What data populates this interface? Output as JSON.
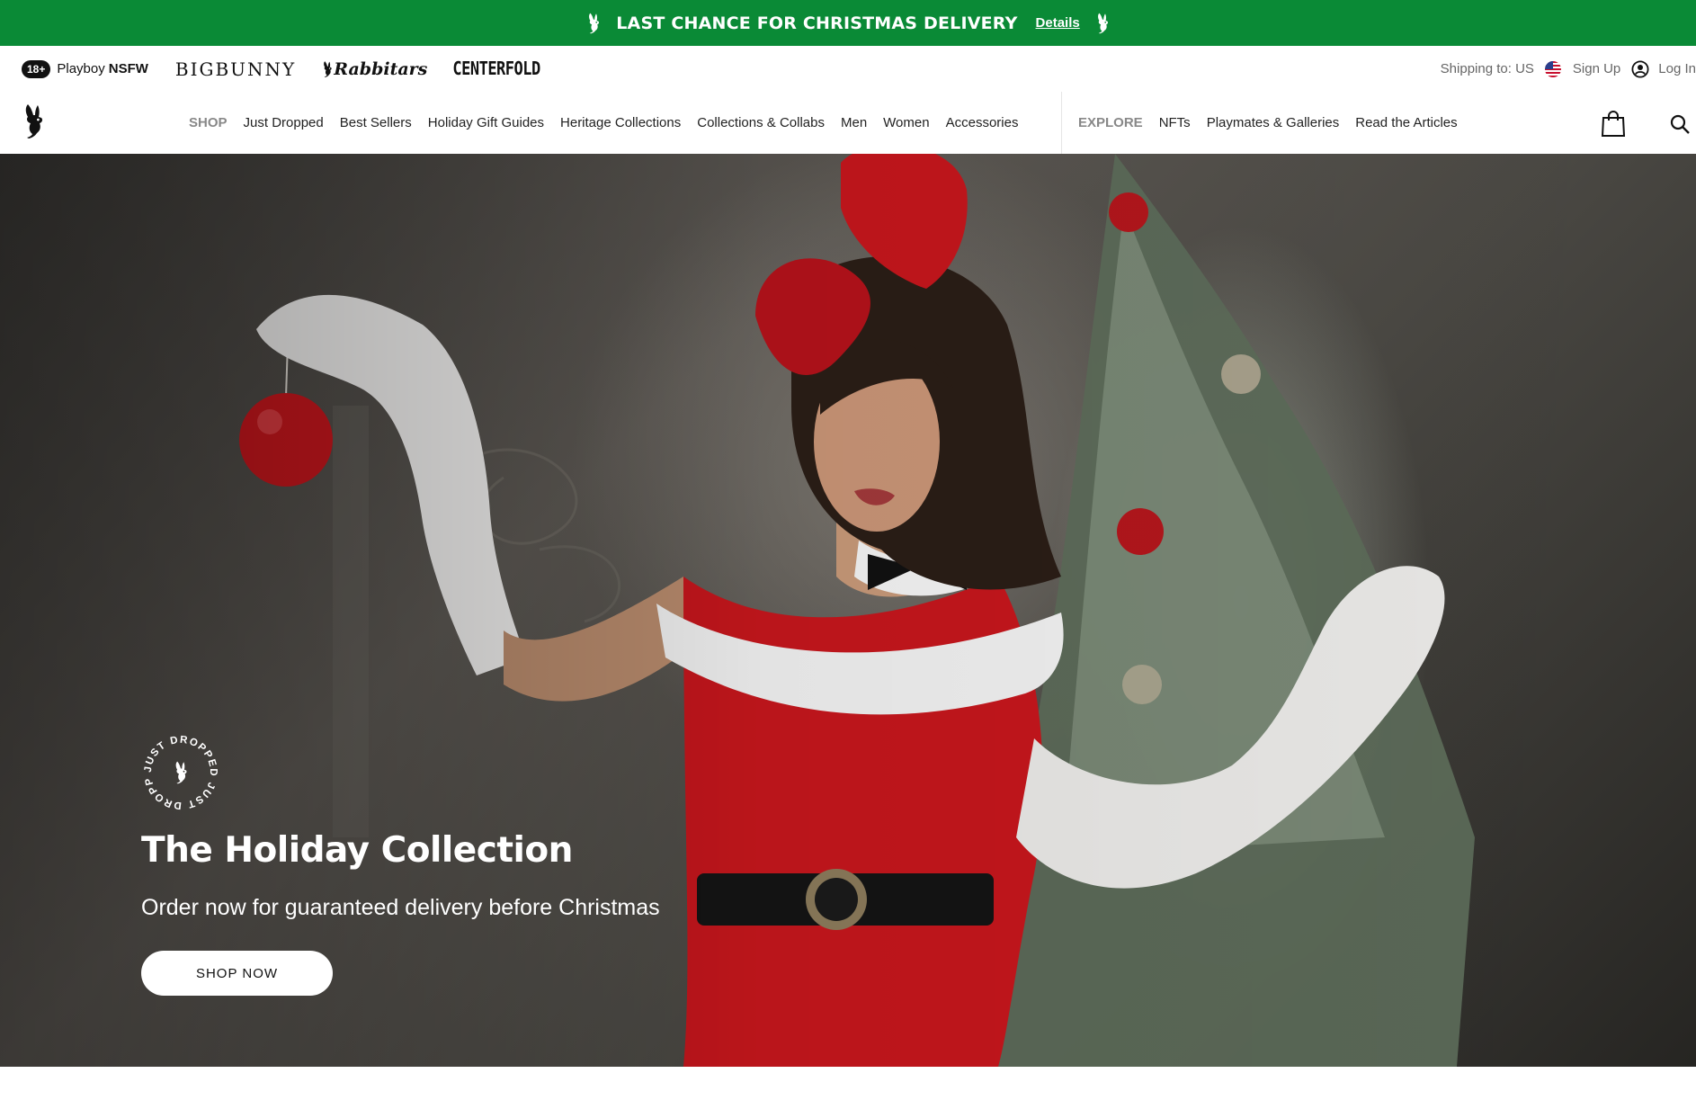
{
  "promo": {
    "text": "LAST CHANCE FOR CHRISTMAS DELIVERY",
    "link": "Details",
    "background": "#0a8a36"
  },
  "brandbar": {
    "age_badge": "18+",
    "nsfw_prefix": "Playboy",
    "nsfw_bold": "NSFW",
    "bigbunny": "BIGBUNNY",
    "rabbitars": "Rabbitars",
    "centerfold": "CENTERFOLD",
    "shipping": "Shipping to: US",
    "sign_up": "Sign Up",
    "log_in": "Log In"
  },
  "nav": {
    "shop_heading": "SHOP",
    "shop_links": [
      "Just Dropped",
      "Best Sellers",
      "Holiday Gift Guides",
      "Heritage Collections",
      "Collections & Collabs",
      "Men",
      "Women",
      "Accessories"
    ],
    "explore_heading": "EXPLORE",
    "explore_links": [
      "NFTs",
      "Playmates & Galleries",
      "Read the Articles"
    ],
    "icons": [
      "playboy-bunny-logo-icon",
      "shopping-bag-icon",
      "search-icon"
    ]
  },
  "hero": {
    "stamp_text": "JUST DROPPED JUST DROPPED",
    "title": "The Holiday Collection",
    "subtitle": "Order now for guaranteed delivery before Christmas",
    "cta": "SHOP NOW",
    "accent_red": "#c4161c"
  }
}
